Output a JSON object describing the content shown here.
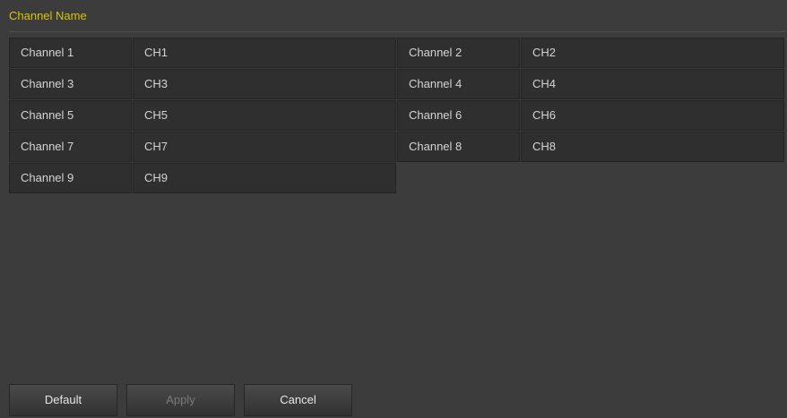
{
  "page": {
    "title": "Channel Name",
    "accent_color": "#d8c400"
  },
  "channels": [
    {
      "label": "Channel 1",
      "value": "CH1"
    },
    {
      "label": "Channel 2",
      "value": "CH2"
    },
    {
      "label": "Channel 3",
      "value": "CH3"
    },
    {
      "label": "Channel 4",
      "value": "CH4"
    },
    {
      "label": "Channel 5",
      "value": "CH5"
    },
    {
      "label": "Channel 6",
      "value": "CH6"
    },
    {
      "label": "Channel 7",
      "value": "CH7"
    },
    {
      "label": "Channel 8",
      "value": "CH8"
    },
    {
      "label": "Channel 9",
      "value": "CH9"
    }
  ],
  "buttons": {
    "default_label": "Default",
    "apply_label": "Apply",
    "cancel_label": "Cancel"
  }
}
